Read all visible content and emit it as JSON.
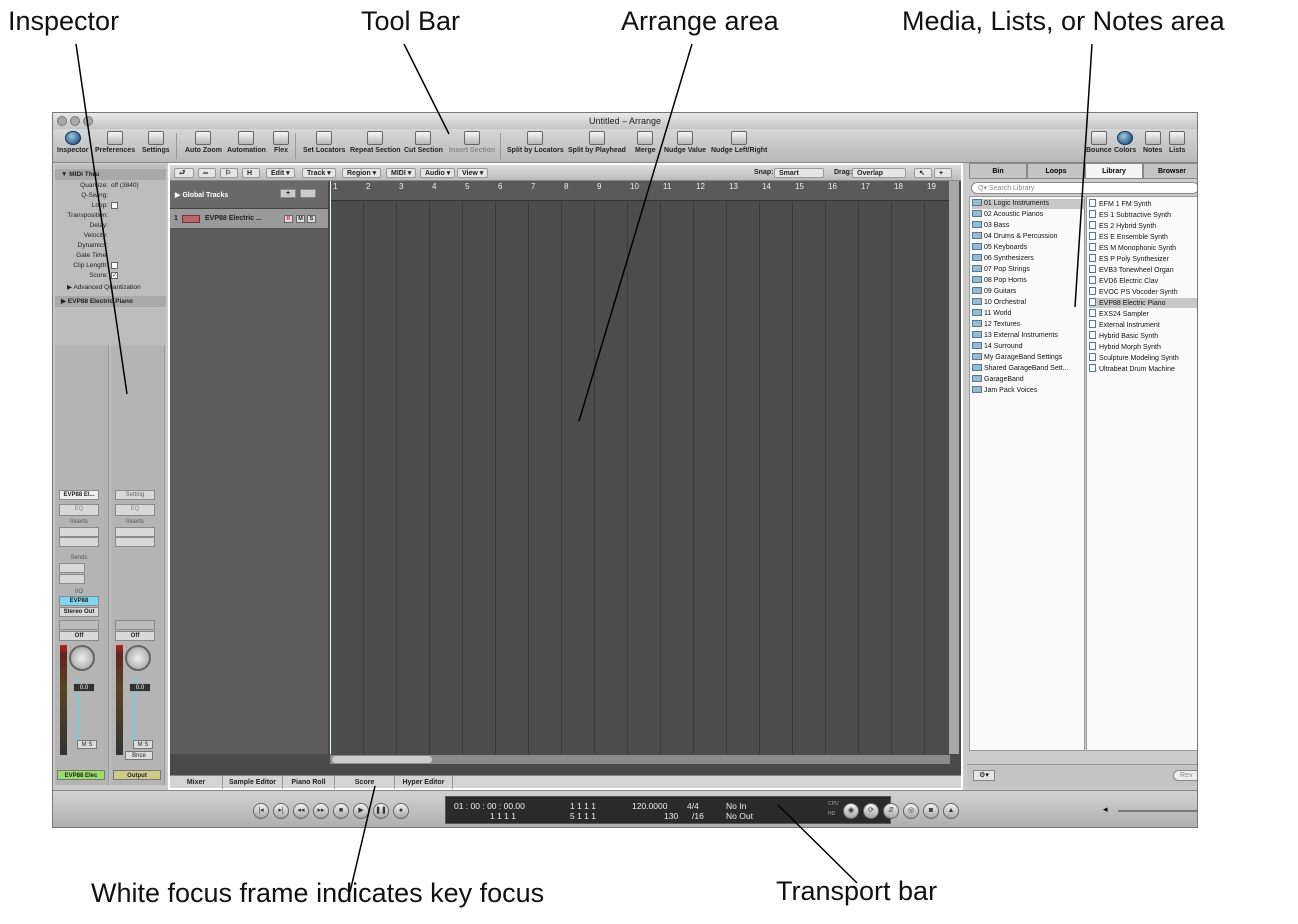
{
  "callouts": {
    "inspector": "Inspector",
    "toolbar": "Tool Bar",
    "arrange": "Arrange area",
    "media": "Media, Lists, or Notes area",
    "focus": "White focus frame indicates key focus",
    "transport": "Transport bar"
  },
  "window": {
    "title": "Untitled – Arrange"
  },
  "toolbar": {
    "inspector": "Inspector",
    "preferences": "Preferences",
    "settings": "Settings",
    "auto_zoom": "Auto Zoom",
    "automation": "Automation",
    "flex": "Flex",
    "set_locators": "Set Locators",
    "repeat_section": "Repeat Section",
    "cut_section": "Cut Section",
    "insert_section": "Insert Section",
    "split_by_locators": "Split by Locators",
    "split_by_playhead": "Split by Playhead",
    "merge": "Merge",
    "nudge_value": "Nudge Value",
    "nudge_left_right": "Nudge Left/Right",
    "bounce": "Bounce",
    "colors": "Colors",
    "notes": "Notes",
    "lists": "Lists"
  },
  "inspector": {
    "midi_thru": "▼ MIDI Thru",
    "params": [
      {
        "label": "Quantize:",
        "value": "off (3840)"
      },
      {
        "label": "Q-Swing:",
        "value": ""
      },
      {
        "label": "Loop:",
        "value": ""
      },
      {
        "label": "Transposition:",
        "value": ""
      },
      {
        "label": "Delay:",
        "value": ""
      },
      {
        "label": "Velocity:",
        "value": ""
      },
      {
        "label": "Dynamics:",
        "value": ""
      },
      {
        "label": "Gate Time:",
        "value": ""
      },
      {
        "label": "Clip Length:",
        "value": ""
      },
      {
        "label": "Score:",
        "value": ""
      }
    ],
    "advanced_quantization": "▶ Advanced Quantization",
    "track_name": "▶ EVP88 Electric Piano",
    "strip_left": {
      "setting": "EVP88 El...",
      "eq": "EQ",
      "inserts": "Inserts",
      "sends": "Sends",
      "io": "I/O",
      "input": "EVP88",
      "output": "Stereo Out",
      "automation": "Off",
      "volume": "0.0",
      "mute_solo": "M S",
      "name": "EVP88 Elec"
    },
    "strip_right": {
      "setting": "Setting",
      "eq": "EQ",
      "inserts": "Inserts",
      "automation": "Off",
      "volume": "0.0",
      "mute_solo": "M S",
      "bnce": "Bnce",
      "name": "Output"
    }
  },
  "arrange": {
    "menus": [
      "Edit ▾",
      "Track ▾",
      "Region ▾",
      "MIDI ▾",
      "Audio ▾",
      "View ▾"
    ],
    "snap_label": "Snap:",
    "snap_value": "Smart",
    "drag_label": "Drag:",
    "drag_value": "Overlap",
    "global_tracks": "▶ Global Tracks",
    "track_number": "1",
    "track_name": "EVP88 Electric ...",
    "bars": [
      "1",
      "2",
      "3",
      "4",
      "5",
      "6",
      "7",
      "8",
      "9",
      "10",
      "11",
      "12",
      "13",
      "14",
      "15",
      "16",
      "17",
      "18",
      "19"
    ],
    "tabs": [
      "Mixer",
      "Sample Editor",
      "Piano Roll",
      "Score",
      "Hyper Editor"
    ]
  },
  "media": {
    "tabs": [
      "Bin",
      "Loops",
      "Library",
      "Browser"
    ],
    "search_placeholder": "Q▾ Search Library",
    "folders": [
      "01 Logic Instruments",
      "02 Acoustic Pianos",
      "03 Bass",
      "04 Drums & Percussion",
      "05 Keyboards",
      "06 Synthesizers",
      "07 Pop Strings",
      "08 Pop Horns",
      "09 Guitars",
      "10 Orchestral",
      "11 World",
      "12 Textures",
      "13 External Instruments",
      "14 Surround",
      "My GarageBand Settings",
      "Shared GarageBand Sett...",
      "GarageBand",
      "Jam Pack Voices"
    ],
    "patches": [
      "EFM 1 FM Synth",
      "ES 1 Subtractive Synth",
      "ES 2 Hybrid Synth",
      "ES E Ensemble Synth",
      "ES M Monophonic Synth",
      "ES P Poly Synthesizer",
      "EVB3 Tonewheel Organ",
      "EVD6 Electric Clav",
      "EVOC PS Vocoder Synth",
      "EVP88 Electric Piano",
      "EXS24 Sampler",
      "External Instrument",
      "Hybrid Basic Synth",
      "Hybrid Morph Synth",
      "Sculpture Modeling Synth",
      "Ultrabeat Drum Machine"
    ],
    "revert": "Rev"
  },
  "transport": {
    "smpte": "01 : 00 : 00 : 00.00",
    "bars_top": "1   1   1   1",
    "bars_sub": "1   1   1   1",
    "locator_left": "1   1   1   1",
    "locator_right": "5   1   1   1",
    "tempo": "120.0000",
    "tempo_sub": "130",
    "signature": "4/4",
    "division": "/16",
    "midi_in": "No In",
    "midi_out": "No Out",
    "cpu": "CPU",
    "hd": "HD"
  }
}
